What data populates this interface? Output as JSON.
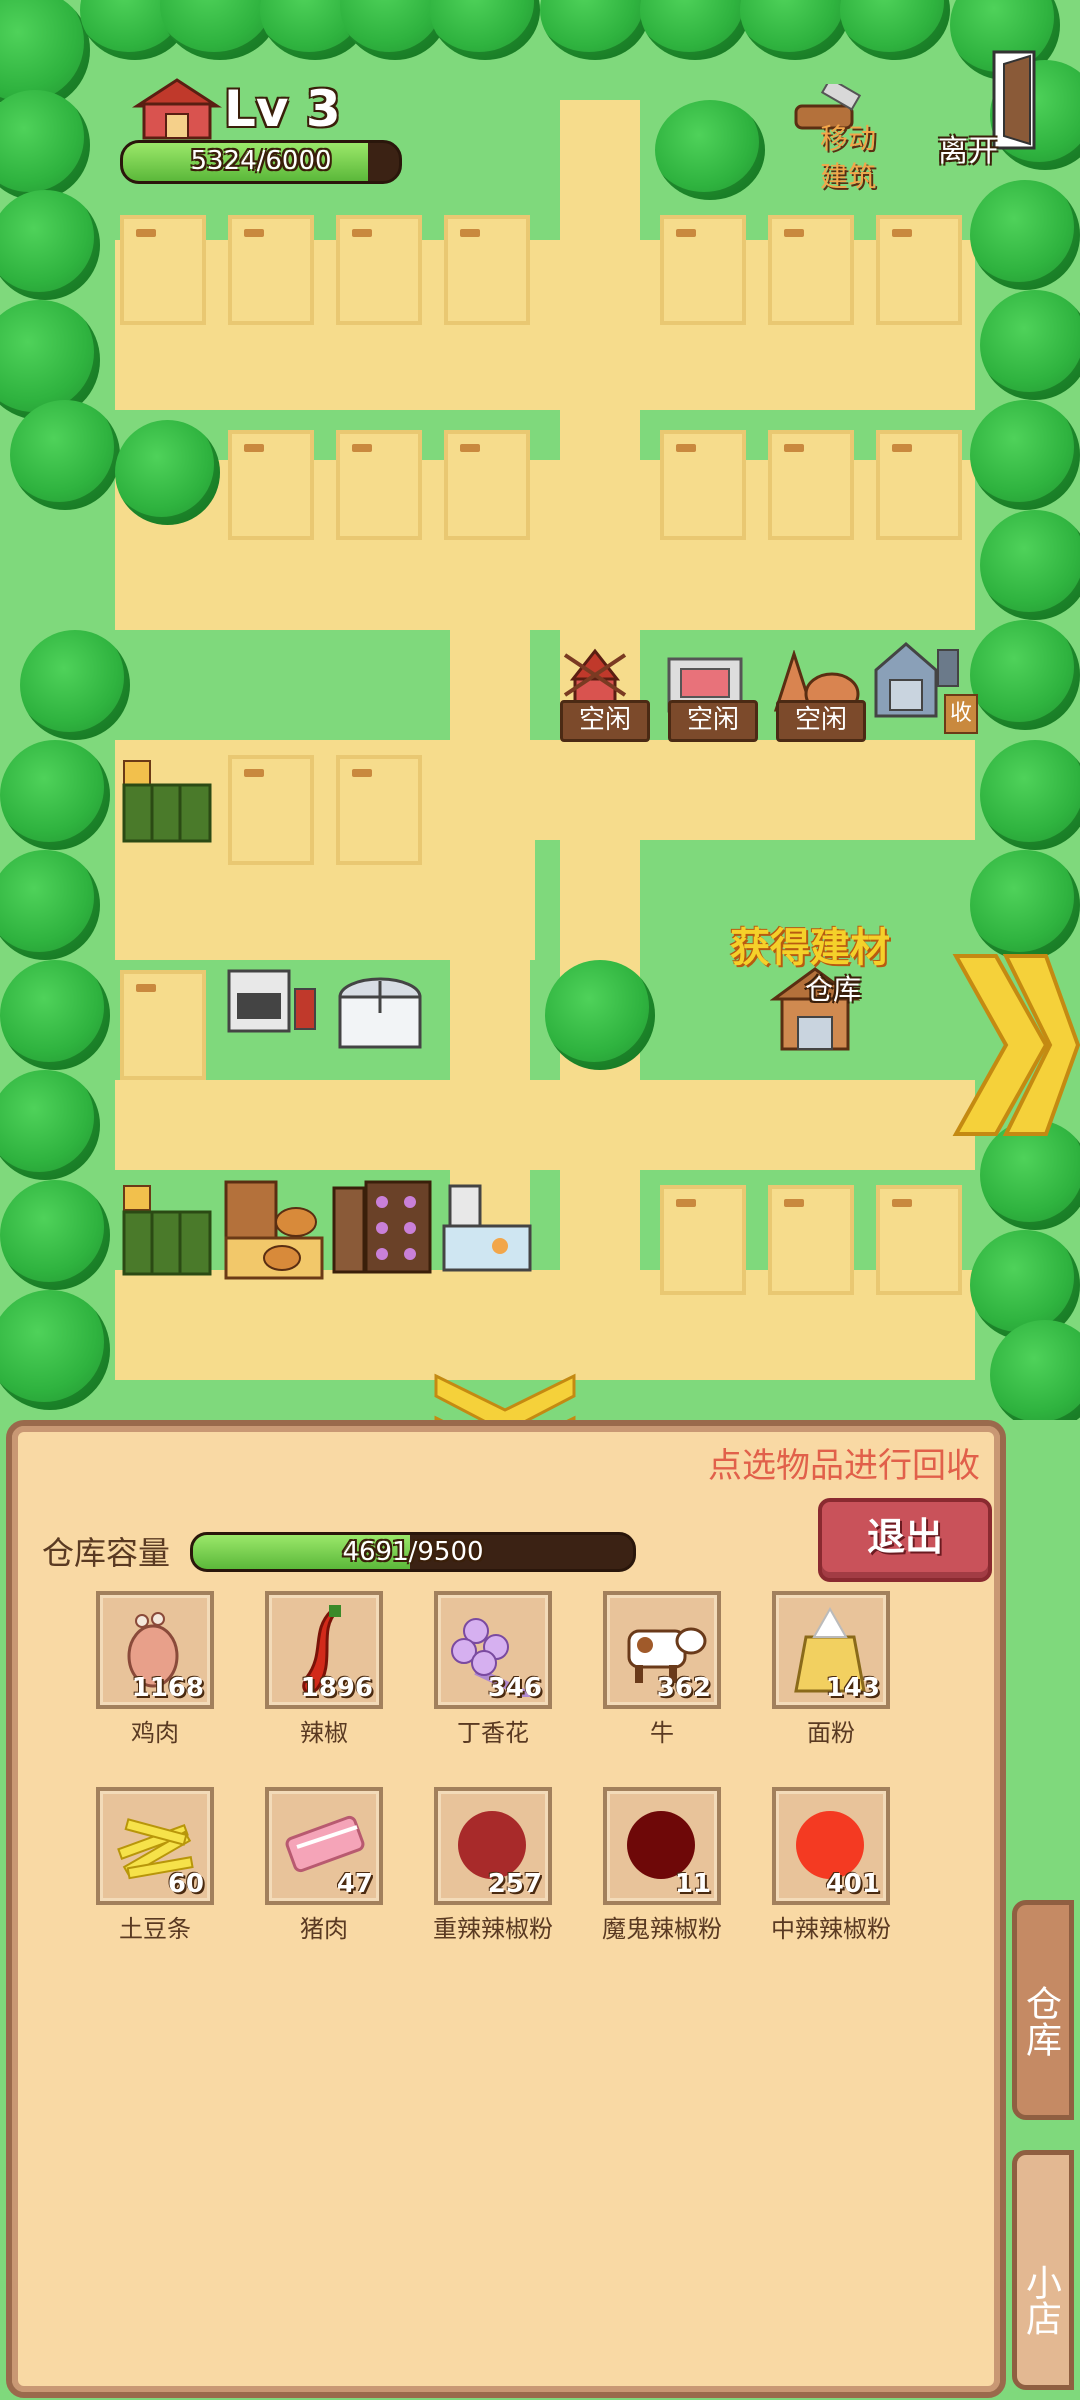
{
  "hud": {
    "level": "Lv 3",
    "exp_text": "5324/6000",
    "exp_fraction": 0.887,
    "move_building_label": "移动\n建筑",
    "leave_label": "离开"
  },
  "map": {
    "idle_labels": [
      "空闲",
      "空闲",
      "空闲"
    ],
    "collect_tag": "收",
    "obtain_material_text": "获得建材",
    "warehouse_label": "仓库"
  },
  "panel": {
    "hint": "点选物品进行回收",
    "capacity_label": "仓库容量",
    "capacity_text": "4691/9500",
    "capacity_fraction": 0.494,
    "exit_label": "退出",
    "items": [
      {
        "name": "鸡肉",
        "qty": "1168",
        "icon": "chicken-meat-icon"
      },
      {
        "name": "辣椒",
        "qty": "1896",
        "icon": "chili-pepper-icon"
      },
      {
        "name": "丁香花",
        "qty": "346",
        "icon": "clove-flower-icon"
      },
      {
        "name": "牛",
        "qty": "362",
        "icon": "cow-icon"
      },
      {
        "name": "面粉",
        "qty": "143",
        "icon": "flour-sack-icon"
      },
      {
        "name": "土豆条",
        "qty": "60",
        "icon": "fries-icon"
      },
      {
        "name": "猪肉",
        "qty": "47",
        "icon": "pork-icon"
      },
      {
        "name": "重辣辣椒粉",
        "qty": "257",
        "icon": "chili-powder-heavy-icon"
      },
      {
        "name": "魔鬼辣椒粉",
        "qty": "11",
        "icon": "chili-powder-devil-icon"
      },
      {
        "name": "中辣辣椒粉",
        "qty": "401",
        "icon": "chili-powder-medium-icon"
      }
    ]
  },
  "side_tabs": {
    "warehouse": "仓库",
    "shop": "小店"
  },
  "colors": {
    "grass": "#7fd97c",
    "dirt": "#f6dc8c",
    "panel_bg": "#f9d9a4",
    "exit_button": "#c9525a",
    "hint_text": "#e1604a",
    "highlight_text": "#f5d12a"
  }
}
